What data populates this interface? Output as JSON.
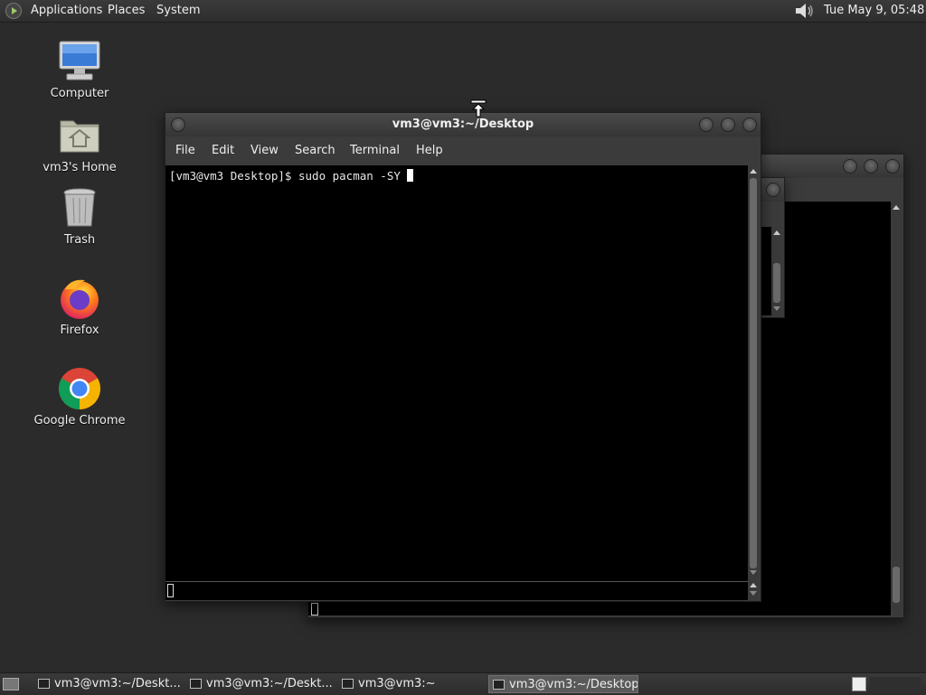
{
  "top_panel": {
    "menus": [
      "Applications",
      "Places",
      "System"
    ],
    "clock": "Tue May  9, 05:48"
  },
  "desktop_icons": [
    {
      "label": "Computer",
      "icon": "computer-icon"
    },
    {
      "label": "vm3's Home",
      "icon": "home-folder-icon"
    },
    {
      "label": "Trash",
      "icon": "trash-icon"
    },
    {
      "label": "Firefox",
      "icon": "firefox-icon"
    },
    {
      "label": "Google Chrome",
      "icon": "chrome-icon"
    }
  ],
  "terminal": {
    "title": "vm3@vm3:~/Desktop",
    "menu": [
      "File",
      "Edit",
      "View",
      "Search",
      "Terminal",
      "Help"
    ],
    "prompt": "[vm3@vm3 Desktop]$ sudo pacman -SY "
  },
  "taskbar": {
    "tasks": [
      {
        "label": "vm3@vm3:~/Deskt...",
        "active": false
      },
      {
        "label": "vm3@vm3:~/Deskt...",
        "active": false
      },
      {
        "label": "vm3@vm3:~",
        "active": false
      },
      {
        "label": "vm3@vm3:~/Desktop",
        "active": true
      }
    ]
  },
  "colors": {
    "desktop_bg": "#2b2b2b",
    "panel_bg": "#333333",
    "terminal_bg": "#000000"
  }
}
